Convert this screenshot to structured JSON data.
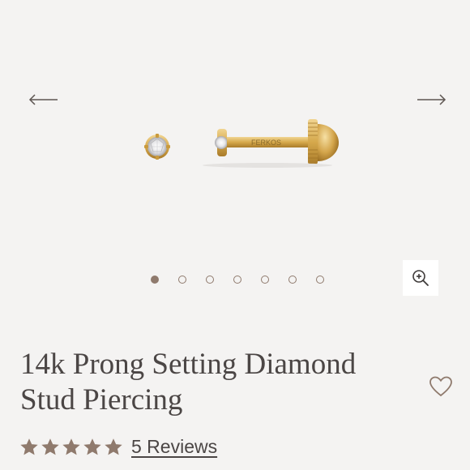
{
  "gallery": {
    "prev_icon": "arrow-left-icon",
    "next_icon": "arrow-right-icon",
    "engraving": "FERKOS",
    "dot_count": 7,
    "active_index": 1,
    "zoom_icon": "zoom-in-icon"
  },
  "product": {
    "title": "14k Prong Setting Diamond Stud Piercing",
    "wishlist_icon": "heart-icon",
    "rating": 5,
    "reviews_label": "5 Reviews"
  },
  "colors": {
    "accent": "#8f7a6d",
    "text": "#4b4645",
    "background": "#f4f3f2",
    "gold": "#d9b25a"
  }
}
